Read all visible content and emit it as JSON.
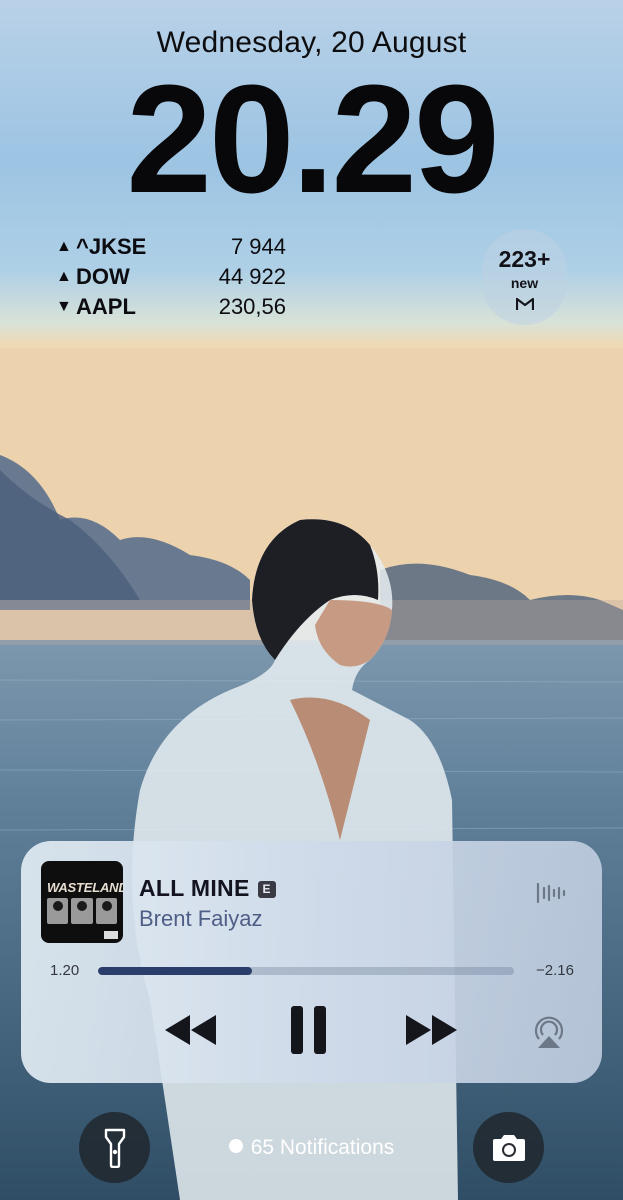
{
  "lockscreen": {
    "date": "Wednesday, 20 August",
    "time": "20.29"
  },
  "stocks": [
    {
      "direction": "up",
      "arrow": "▲",
      "symbol": "^JKSE",
      "value": "7 944"
    },
    {
      "direction": "up",
      "arrow": "▲",
      "symbol": "DOW",
      "value": "44 922"
    },
    {
      "direction": "down",
      "arrow": "▼",
      "symbol": "AAPL",
      "value": "230,56"
    }
  ],
  "mail_widget": {
    "count": "223+",
    "label": "new",
    "icon": "gmail-icon"
  },
  "now_playing": {
    "album_art_text": "WASTELAND",
    "title": "ALL MINE",
    "explicit_badge": "E",
    "artist": "Brent Faiyaz",
    "elapsed": "1.20",
    "remaining": "−2.16",
    "progress_fraction": 0.37,
    "icons": {
      "waveform": "waveform-icon",
      "previous": "rewind-icon",
      "play_pause": "pause-icon",
      "next": "fast-forward-icon",
      "airplay": "airplay-icon"
    }
  },
  "bottom_bar": {
    "flashlight_icon": "flashlight-icon",
    "camera_icon": "camera-icon",
    "notifications_label": "65 Notifications"
  },
  "colors": {
    "progress_fill": "#2b3d6b",
    "artist_text": "#4f5e86"
  }
}
